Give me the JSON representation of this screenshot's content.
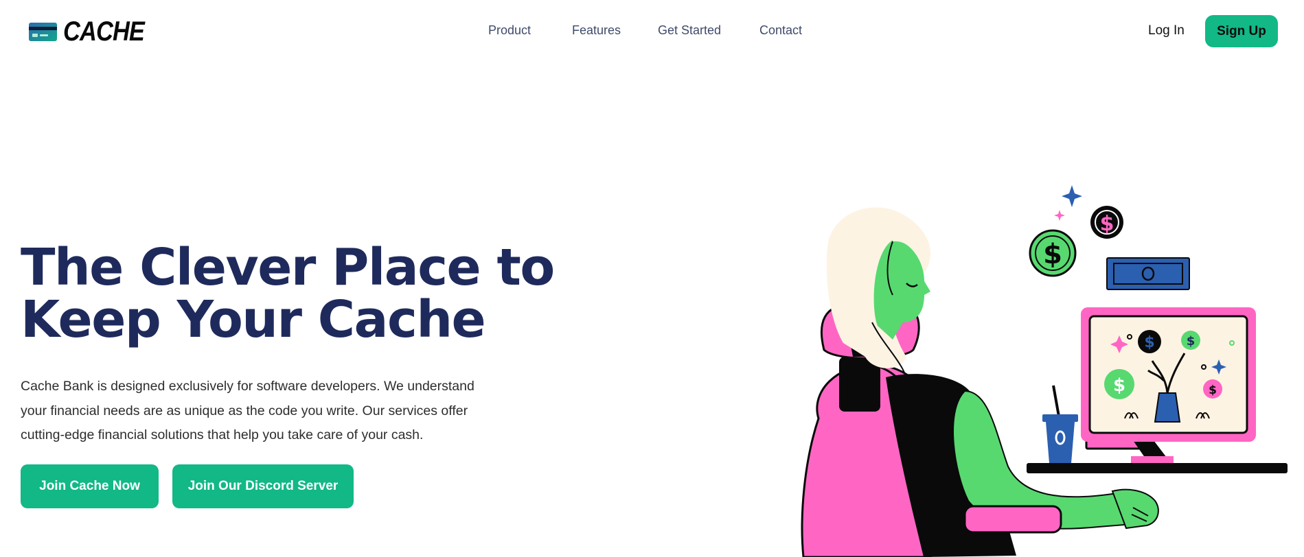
{
  "brand": {
    "name": "CACHE",
    "logo_icon": "credit-card-icon"
  },
  "nav": {
    "items": [
      {
        "label": "Product"
      },
      {
        "label": "Features"
      },
      {
        "label": "Get Started"
      },
      {
        "label": "Contact"
      }
    ]
  },
  "auth": {
    "login_label": "Log In",
    "signup_label": "Sign Up"
  },
  "hero": {
    "title_line1": "The Clever Place to",
    "title_line2": "Keep Your Cache",
    "description": "Cache Bank is designed exclusively for software developers. We understand your financial needs are as unique as the code you write. Our services offer cutting-edge financial solutions that help you take care of your cash.",
    "primary_cta": "Join Cache Now",
    "secondary_cta": "Join Our Discord Server"
  },
  "colors": {
    "accent": "#12b886",
    "heading": "#1f2a5c",
    "nav_text": "#3f4a6b",
    "pink": "#ff66c4",
    "green": "#57d970",
    "blue": "#2b5fb0",
    "cream": "#fdf3e3"
  }
}
